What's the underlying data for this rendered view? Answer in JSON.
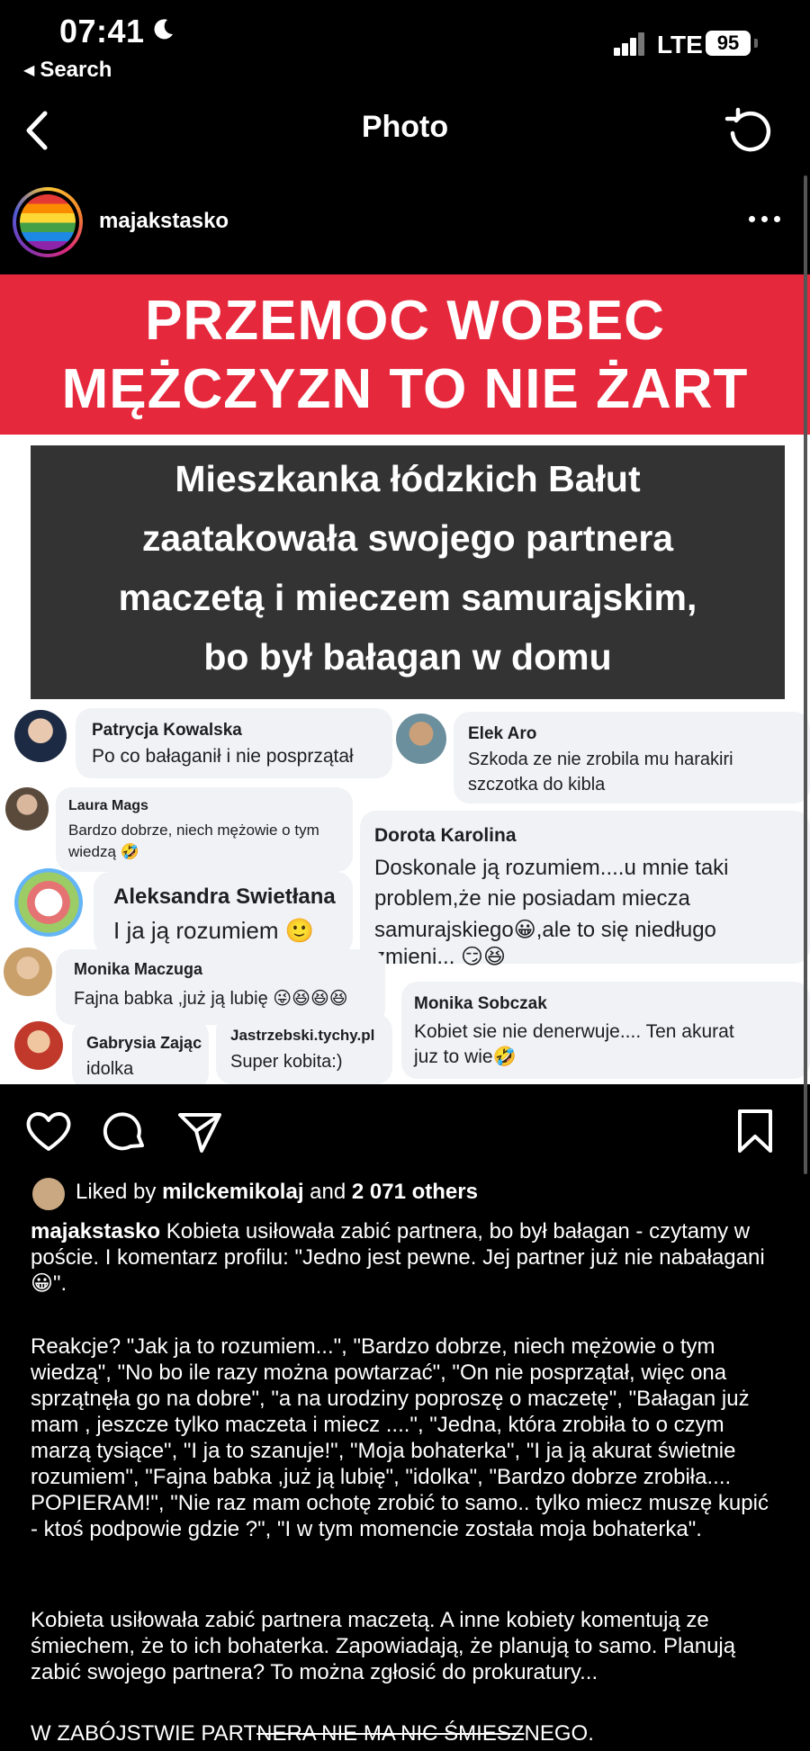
{
  "status_bar": {
    "time": "07:41",
    "back_app": "Search",
    "network": "LTE",
    "battery": "95"
  },
  "nav": {
    "title": "Photo"
  },
  "post": {
    "username": "majakstasko"
  },
  "image": {
    "banner_line1": "PRZEMOC WOBEC",
    "banner_line2": "MĘŻCZYZN  TO NIE ŻART",
    "headline": [
      "Mieszkanka łódzkich Bałut",
      "zaatakowała swojego partnera",
      "maczetą i mieczem samurajskim,",
      "bo był bałagan w domu"
    ],
    "comments": [
      {
        "name": "Patrycja Kowalska",
        "text": [
          "Po co bałaganił i nie posprzątał"
        ]
      },
      {
        "name": "Elek Aro",
        "text": [
          "Szkoda ze nie zrobila mu harakiri",
          "szczotka do kibla"
        ]
      },
      {
        "name": "Laura Mags",
        "text": [
          "Bardzo dobrze, niech mężowie o tym",
          "wiedzą 🤣"
        ]
      },
      {
        "name": "Dorota Karolina",
        "text": [
          "Doskonale ją rozumiem....u mnie taki",
          "problem,że nie posiadam miecza",
          "samurajskiego😀,ale to się niedługo",
          "zmieni... 😏😆"
        ]
      },
      {
        "name": "Aleksandra Swietłana",
        "text": [
          "I ja ją rozumiem 🙂"
        ]
      },
      {
        "name": "Monika Maczuga",
        "text": [
          "Fajna babka ,już ją lubię 😜😆😆😆"
        ]
      },
      {
        "name": "Gabrysia Zając",
        "text": [
          "idolka"
        ]
      },
      {
        "name": "Jastrzebski.tychy.pl",
        "text": [
          "Super kobita:)"
        ]
      },
      {
        "name": "Monika Sobczak",
        "text": [
          "Kobiet sie nie denerwuje.... Ten akurat",
          "juz to wie🤣"
        ]
      }
    ]
  },
  "likes": {
    "prefix": "Liked by ",
    "user": "milckemikolaj",
    "middle": " and ",
    "count": "2 071 others"
  },
  "caption": {
    "username": "majakstasko",
    "p1": " Kobieta usiłowała zabić partnera, bo był bałagan - czytamy w poście. I komentarz profilu: \"Jedno jest pewne. Jej partner już nie nabałagani 😀\".",
    "p2": "Reakcje? \"Jak ja to rozumiem...\", \"Bardzo dobrze, niech mężowie o tym wiedzą\", \"No bo ile razy można powtarzać\", \"On nie posprzątał, więc ona sprzątnęła go na dobre\", \"a na urodziny poproszę o maczetę\", \"Bałagan już mam , jeszcze tylko maczeta i miecz ....\", \"Jedna, która zrobiła to o czym marzą tysiące\", \"I ja to szanuje!\", \"Moja bohaterka\", \"I ja ją akurat świetnie rozumiem\", \"Fajna babka ,już ją lubię\", \"idolka\", \"Bardzo dobrze zrobiła.... POPIERAM!\", \"Nie raz mam ochotę zrobić to samo.. tylko miecz muszę kupić - ktoś podpowie gdzie ?\", \"I w tym momencie została moja bohaterka\".",
    "p3": "Kobieta usiłowała zabić partnera maczetą. A inne kobiety komentują ze śmiechem, że to ich bohaterka. Zapowiadają, że planują to samo. Planują zabić swojego partnera? To można zgłosić do prokuratury...",
    "p4a": "W ZABÓJSTWIE PART",
    "p4b": "NERA NIE MA NIC ŚMIESZ",
    "p4c": "NEGO."
  },
  "colors": {
    "banner_red": "#e6283c",
    "dark_box": "#333333",
    "comment_bg": "#f0f2f5"
  }
}
